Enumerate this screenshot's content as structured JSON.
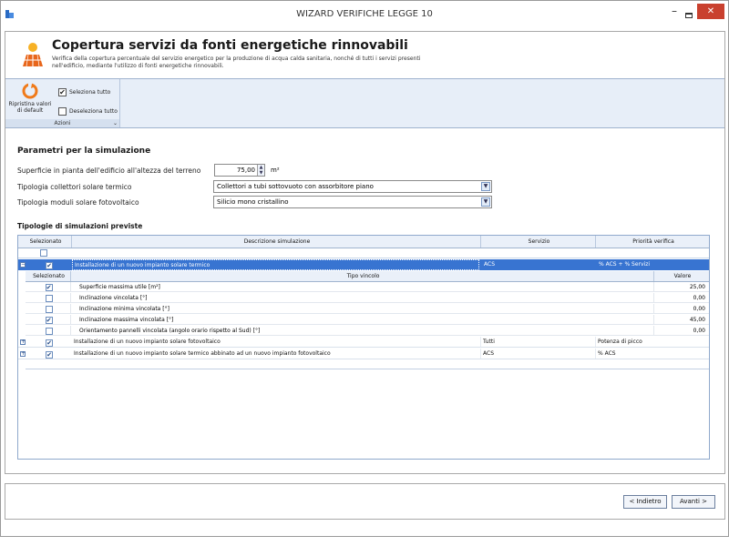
{
  "window": {
    "title": "WIZARD VERIFICHE LEGGE 10",
    "minimize": "–",
    "close": "✕"
  },
  "header": {
    "title": "Copertura servizi da fonti energetiche rinnovabili",
    "description": "Verifica della copertura percentuale del servizio energetico per la produzione di acqua calda sanitaria, nonché di tutti i servizi presenti nell'edificio, mediante l'utilizzo di fonti energetiche rinnovabili."
  },
  "ribbon": {
    "reset_label": "Ripristina valori di default",
    "select_all": "Seleziona tutto",
    "deselect_all": "Deseleziona tutto",
    "group_label": "Azioni"
  },
  "params": {
    "title": "Parametri per la simulazione",
    "surface_label": "Superficie in pianta dell'edificio all'altezza del terreno",
    "surface_value": "75,00",
    "surface_unit": "m²",
    "collector_label": "Tipologia collettori solare termico",
    "collector_value": "Collettori a tubi sottovuoto con assorbitore piano",
    "pv_label": "Tipologia moduli solare fotovoltaico",
    "pv_value": "Silicio mono cristallino"
  },
  "simulations": {
    "title": "Tipologie di simulazioni previste",
    "columns": [
      "Selezionato",
      "Descrizione simulazione",
      "Servizio",
      "Priorità verifica"
    ],
    "rows": [
      {
        "checked": true,
        "description": "Installazione di un nuovo impianto solare termico",
        "service": "ACS",
        "priority": "% ACS + % Servizi",
        "expanded": true
      },
      {
        "checked": true,
        "description": "Installazione di un nuovo impianto solare fotovoltaico",
        "service": "Tutti",
        "priority": "Potenza di picco",
        "expanded": false
      },
      {
        "checked": true,
        "description": "Installazione di un nuovo impianto solare termico abbinato ad un nuovo impianto fotovoltaico",
        "service": "ACS",
        "priority": "% ACS",
        "expanded": false
      }
    ],
    "detail": {
      "columns": [
        "Selezionato",
        "Tipo vincolo",
        "Valore"
      ],
      "rows": [
        {
          "checked": true,
          "type": "Superficie massima utile [m²]",
          "value": "25,00"
        },
        {
          "checked": false,
          "type": "Inclinazione vincolata [°]",
          "value": "0,00"
        },
        {
          "checked": false,
          "type": "Inclinazione minima vincolata [°]",
          "value": "0,00"
        },
        {
          "checked": true,
          "type": "Inclinazione massima vincolata [°]",
          "value": "45,00"
        },
        {
          "checked": false,
          "type": "Orientamento pannelli vincolata (angolo orario rispetto al Sud) [°]",
          "value": "0,00"
        }
      ]
    }
  },
  "nav": {
    "back": "< Indietro",
    "next": "Avanti >"
  },
  "colors": {
    "selection": "#3874d1",
    "accent": "#f39a1e",
    "close_button": "#c9402e"
  }
}
